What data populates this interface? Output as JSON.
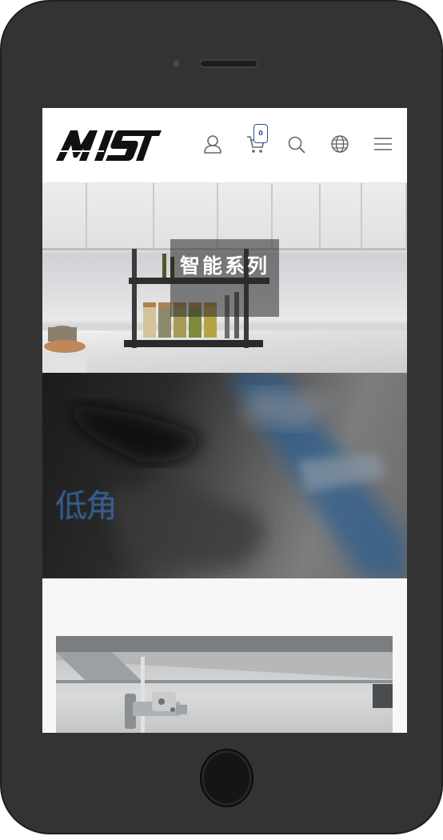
{
  "device": {
    "model": "smartphone-frame"
  },
  "header": {
    "logo_text": "MST",
    "cart_count": "0",
    "icons": [
      "user-icon",
      "cart-icon",
      "search-icon",
      "globe-icon",
      "menu-icon"
    ]
  },
  "banner": {
    "title": "智能系列"
  },
  "video": {
    "overlay_text": "低角"
  },
  "colors": {
    "accent": "#2c4d9c",
    "frame": "#333333",
    "banner_overlay": "#3a3a3a"
  }
}
